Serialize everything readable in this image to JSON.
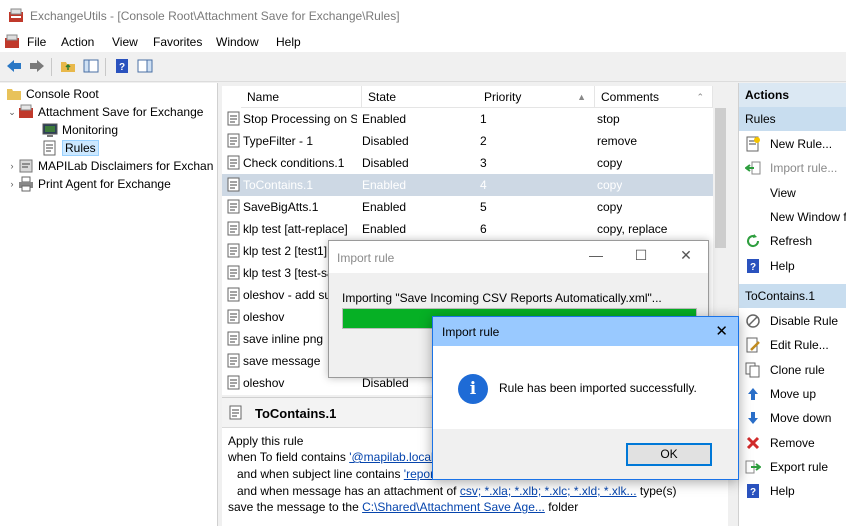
{
  "window": {
    "title": "ExchangeUtils - [Console Root\\Attachment Save for Exchange\\Rules]"
  },
  "menu": [
    "File",
    "Action",
    "View",
    "Favorites",
    "Window",
    "Help"
  ],
  "tree": {
    "root": "Console Root",
    "items": [
      {
        "label": "Attachment Save for Exchange",
        "expanded": true
      },
      {
        "label": "Monitoring"
      },
      {
        "label": "Rules",
        "selected": true
      },
      {
        "label": "MAPILab Disclaimers for Exchan",
        "expanded": false
      },
      {
        "label": "Print Agent for Exchange",
        "expanded": false
      }
    ]
  },
  "list": {
    "columns": [
      "Name",
      "State",
      "Priority",
      "Comments"
    ],
    "rows": [
      {
        "name": "Stop Processing on S...",
        "state": "Enabled",
        "priority": "1",
        "comments": "stop"
      },
      {
        "name": "TypeFilter - 1",
        "state": "Disabled",
        "priority": "2",
        "comments": "remove"
      },
      {
        "name": "Check conditions.1",
        "state": "Disabled",
        "priority": "3",
        "comments": "copy"
      },
      {
        "name": "ToContains.1",
        "state": "Enabled",
        "priority": "4",
        "comments": "copy",
        "selected": true
      },
      {
        "name": "SaveBigAtts.1",
        "state": "Enabled",
        "priority": "5",
        "comments": "copy"
      },
      {
        "name": "klp test [att-replace]",
        "state": "Enabled",
        "priority": "6",
        "comments": "copy, replace"
      },
      {
        "name": "klp test 2 [test1]",
        "state": "",
        "priority": "",
        "comments": ""
      },
      {
        "name": "klp test 3 [test-sav",
        "state": "",
        "priority": "",
        "comments": ""
      },
      {
        "name": "oleshov - add suffi",
        "state": "",
        "priority": "",
        "comments": ""
      },
      {
        "name": "oleshov",
        "state": "",
        "priority": "",
        "comments": ""
      },
      {
        "name": "save inline png",
        "state": "",
        "priority": "",
        "comments": ""
      },
      {
        "name": "save message",
        "state": "",
        "priority": "",
        "comments": ""
      },
      {
        "name": "oleshov",
        "state": "Disabled",
        "priority": "",
        "comments": ""
      }
    ]
  },
  "detail": {
    "title": "ToContains.1",
    "line1": "Apply this rule",
    "line2_prefix": "when To field contains ",
    "line2_link": "'@mapilab.local'",
    "line3_prefix": "and when subject line contains ",
    "line3_link": "'report'",
    "line4_prefix": "and when message has an attachment of ",
    "line4_link": "csv; *.xla; *.xlb; *.xlc; *.xld; *.xlk...",
    "line4_suffix": " type(s)",
    "line5_prefix": "save the message to the ",
    "line5_link": "C:\\Shared\\Attachment Save Age...",
    "line5_suffix": " folder"
  },
  "actions": {
    "header": "Actions",
    "section1": "Rules",
    "items1": [
      {
        "label": "New Rule...",
        "icon": "new-rule-icon"
      },
      {
        "label": "Import rule...",
        "icon": "import-icon",
        "disabled": true
      },
      {
        "label": "View",
        "icon": ""
      },
      {
        "label": "New Window f",
        "icon": ""
      },
      {
        "label": "Refresh",
        "icon": "refresh-icon"
      },
      {
        "label": "Help",
        "icon": "help-icon"
      }
    ],
    "section2": "ToContains.1",
    "items2": [
      {
        "label": "Disable Rule",
        "icon": "disable-icon"
      },
      {
        "label": "Edit Rule...",
        "icon": "edit-icon"
      },
      {
        "label": "Clone rule",
        "icon": "clone-icon"
      },
      {
        "label": "Move up",
        "icon": "arrow-up-icon"
      },
      {
        "label": "Move down",
        "icon": "arrow-down-icon"
      },
      {
        "label": "Remove",
        "icon": "remove-icon"
      },
      {
        "label": "Export rule",
        "icon": "export-icon"
      },
      {
        "label": "Help",
        "icon": "help-icon"
      }
    ]
  },
  "progress_dialog": {
    "title": "Import rule",
    "text": "Importing \"Save Incoming CSV Reports Automatically.xml\"...",
    "progress": 1.0,
    "color": "#06b025"
  },
  "message_dialog": {
    "title": "Import rule",
    "message": "Rule has been imported successfully.",
    "ok_label": "OK"
  }
}
